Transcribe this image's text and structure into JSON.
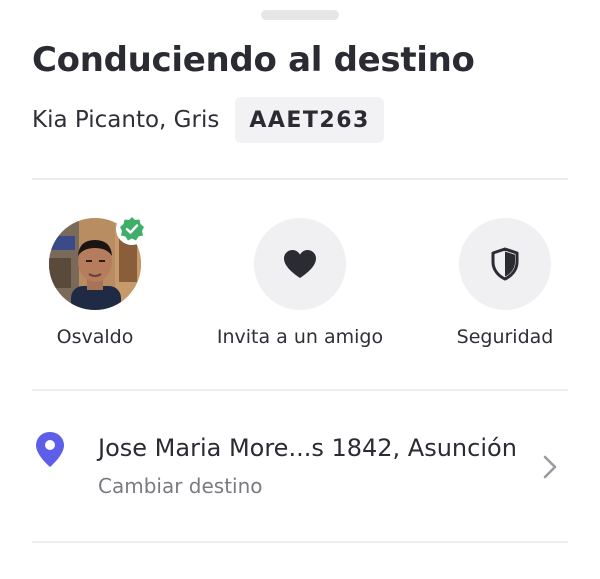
{
  "trip": {
    "status_title": "Conduciendo al destino",
    "vehicle": "Kia Picanto, Gris",
    "plate": "AAET263"
  },
  "actions": [
    {
      "label": "Osvaldo",
      "icon": "driver-avatar"
    },
    {
      "label": "Invita a un amigo",
      "icon": "heart-icon"
    },
    {
      "label": "Seguridad",
      "icon": "shield-icon"
    }
  ],
  "destination": {
    "address": "Jose Maria More...s 1842, Asunción",
    "change_label": "Cambiar destino",
    "pin_color": "#5d5fe8"
  },
  "colors": {
    "verified_badge": "#3fae6a",
    "text_primary": "#2b2b33",
    "text_secondary": "#7a7a82"
  }
}
